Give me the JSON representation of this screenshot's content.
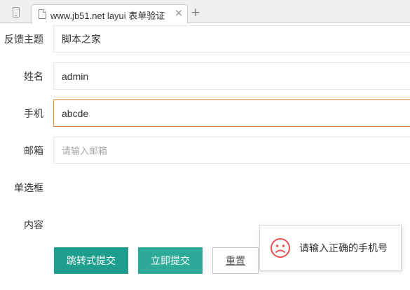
{
  "browser": {
    "tab_title": "www.jb51.net layui 表单验证",
    "tab_close": "×",
    "new_tab": "+"
  },
  "form": {
    "fields": [
      {
        "label": "反馈主题",
        "value": "脚本之家"
      },
      {
        "label": "姓名",
        "value": "admin"
      },
      {
        "label": "手机",
        "value": "abcde",
        "state": "error"
      },
      {
        "label": "邮箱",
        "placeholder": "请输入邮箱"
      }
    ],
    "radio_label": "单选框",
    "content_label": "内容",
    "buttons": {
      "jump_submit": "跳转式提交",
      "submit_now": "立即提交",
      "reset": "重置"
    }
  },
  "toast": {
    "icon": "sad-face-icon",
    "message": "请输入正确的手机号",
    "color": "#e9534f"
  },
  "colors": {
    "primary": "#1e9e8c",
    "error_border": "#e0893f",
    "field_border": "#e6e6e6"
  }
}
